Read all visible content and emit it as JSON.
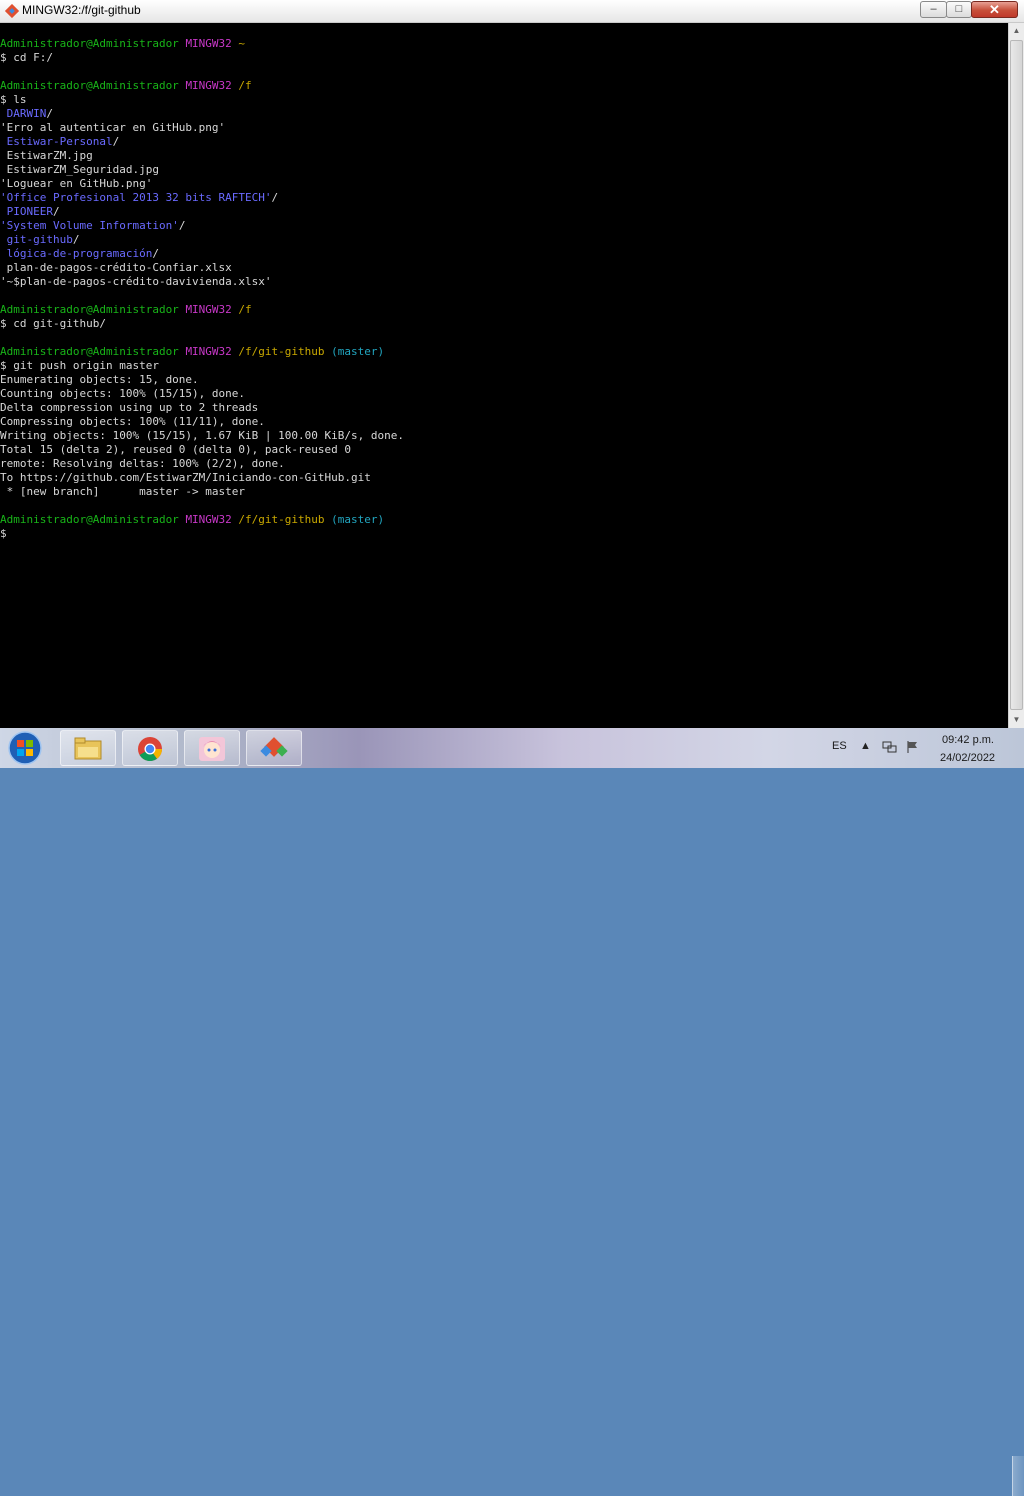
{
  "window": {
    "title": "MINGW32:/f/git-github",
    "controls": {
      "minimize": "–",
      "maximize": "□",
      "close": "✕"
    }
  },
  "terminal": {
    "lines": [
      [
        {
          "t": "Administrador@Administrador",
          "c": "user"
        },
        {
          "t": " "
        },
        {
          "t": "MINGW32",
          "c": "sys"
        },
        {
          "t": " "
        },
        {
          "t": "~",
          "c": "path"
        }
      ],
      [
        {
          "t": "$ cd F:/"
        }
      ],
      [
        {
          "t": ""
        }
      ],
      [
        {
          "t": "Administrador@Administrador",
          "c": "user"
        },
        {
          "t": " "
        },
        {
          "t": "MINGW32",
          "c": "sys"
        },
        {
          "t": " "
        },
        {
          "t": "/f",
          "c": "path"
        }
      ],
      [
        {
          "t": "$ ls"
        }
      ],
      [
        {
          "t": " DARWIN",
          "c": "dir"
        },
        {
          "t": "/"
        }
      ],
      [
        {
          "t": "'Erro al autenticar en GitHub.png'"
        }
      ],
      [
        {
          "t": " Estiwar-Personal",
          "c": "dir"
        },
        {
          "t": "/"
        }
      ],
      [
        {
          "t": " EstiwarZM.jpg"
        }
      ],
      [
        {
          "t": " EstiwarZM_Seguridad.jpg"
        }
      ],
      [
        {
          "t": "'Loguear en GitHub.png'"
        }
      ],
      [
        {
          "t": "'Office Profesional 2013 32 bits RAFTECH'",
          "c": "dir"
        },
        {
          "t": "/"
        }
      ],
      [
        {
          "t": " PIONEER",
          "c": "dir"
        },
        {
          "t": "/"
        }
      ],
      [
        {
          "t": "'System Volume Information'",
          "c": "dir"
        },
        {
          "t": "/"
        }
      ],
      [
        {
          "t": " git-github",
          "c": "dir"
        },
        {
          "t": "/"
        }
      ],
      [
        {
          "t": " lógica-de-programación",
          "c": "dir"
        },
        {
          "t": "/"
        }
      ],
      [
        {
          "t": " plan-de-pagos-crédito-Confiar.xlsx"
        }
      ],
      [
        {
          "t": "'~$plan-de-pagos-crédito-davivienda.xlsx'"
        }
      ],
      [
        {
          "t": ""
        }
      ],
      [
        {
          "t": "Administrador@Administrador",
          "c": "user"
        },
        {
          "t": " "
        },
        {
          "t": "MINGW32",
          "c": "sys"
        },
        {
          "t": " "
        },
        {
          "t": "/f",
          "c": "path"
        }
      ],
      [
        {
          "t": "$ cd git-github/"
        }
      ],
      [
        {
          "t": ""
        }
      ],
      [
        {
          "t": "Administrador@Administrador",
          "c": "user"
        },
        {
          "t": " "
        },
        {
          "t": "MINGW32",
          "c": "sys"
        },
        {
          "t": " "
        },
        {
          "t": "/f/git-github",
          "c": "path"
        },
        {
          "t": " "
        },
        {
          "t": "(master)",
          "c": "br"
        }
      ],
      [
        {
          "t": "$ git push origin master"
        }
      ],
      [
        {
          "t": "Enumerating objects: 15, done."
        }
      ],
      [
        {
          "t": "Counting objects: 100% (15/15), done."
        }
      ],
      [
        {
          "t": "Delta compression using up to 2 threads"
        }
      ],
      [
        {
          "t": "Compressing objects: 100% (11/11), done."
        }
      ],
      [
        {
          "t": "Writing objects: 100% (15/15), 1.67 KiB | 100.00 KiB/s, done."
        }
      ],
      [
        {
          "t": "Total 15 (delta 2), reused 0 (delta 0), pack-reused 0"
        }
      ],
      [
        {
          "t": "remote: Resolving deltas: 100% (2/2), done."
        }
      ],
      [
        {
          "t": "To https://github.com/EstiwarZM/Iniciando-con-GitHub.git"
        }
      ],
      [
        {
          "t": " * [new branch]      master -> master"
        }
      ],
      [
        {
          "t": ""
        }
      ],
      [
        {
          "t": "Administrador@Administrador",
          "c": "user"
        },
        {
          "t": " "
        },
        {
          "t": "MINGW32",
          "c": "sys"
        },
        {
          "t": " "
        },
        {
          "t": "/f/git-github",
          "c": "path"
        },
        {
          "t": " "
        },
        {
          "t": "(master)",
          "c": "br"
        }
      ],
      [
        {
          "t": "$"
        }
      ]
    ]
  },
  "colors": {
    "user": "#18b418",
    "sys": "#c838c8",
    "path": "#c8a800",
    "branch": "#22a6c0",
    "directory": "#6a6aff",
    "text": "#d8d8d8"
  },
  "taskbar": {
    "start_icon": "windows-start-orb",
    "apps": [
      "file-explorer-icon",
      "chrome-icon",
      "anime-avatar-app-icon",
      "git-bash-icon"
    ],
    "language": "ES",
    "clock_time": "09:42 p.m.",
    "clock_date": "24/02/2022"
  }
}
